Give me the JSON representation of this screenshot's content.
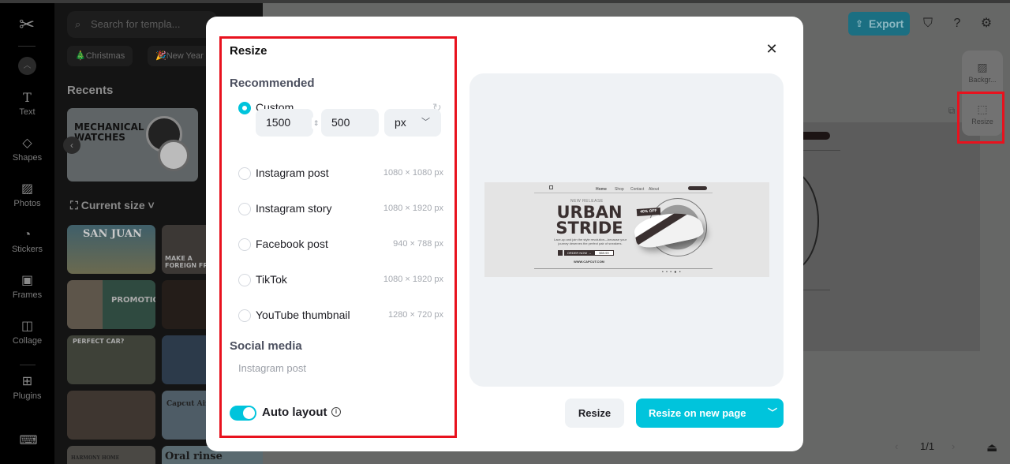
{
  "app": {
    "nav_rail": [
      {
        "label": "Text",
        "icon": "text-icon"
      },
      {
        "label": "Shapes",
        "icon": "shapes-icon"
      },
      {
        "label": "Photos",
        "icon": "photos-icon"
      },
      {
        "label": "Stickers",
        "icon": "stickers-icon"
      },
      {
        "label": "Frames",
        "icon": "frames-icon"
      },
      {
        "label": "Collage",
        "icon": "collage-icon"
      },
      {
        "label": "Plugins",
        "icon": "plugins-icon"
      }
    ],
    "search_placeholder": "Search for templa...",
    "chips": [
      "🎄Christmas",
      "🎉New Year"
    ],
    "recents_title": "Recents",
    "current_size_label": "Current size",
    "thumbnails": [
      {
        "caption": "MECHANICAL WATCHES"
      },
      {
        "caption": "SAN JUAN"
      },
      {
        "caption": "MAKE A FOREIGN FRI"
      },
      {
        "caption": "PROMOTION"
      },
      {
        "caption": "PERFECT CAR?"
      },
      {
        "caption": "Capcut Airline"
      },
      {
        "caption": "HARMONY HOME"
      },
      {
        "caption": "Oral rinse"
      }
    ],
    "export_label": "Export",
    "side_tools": [
      {
        "label": "Backgr...",
        "icon": "background-icon"
      },
      {
        "label": "Resize",
        "icon": "resize-icon"
      }
    ],
    "page_indicator": "1/1"
  },
  "modal": {
    "title": "Resize",
    "recommended_title": "Recommended",
    "custom": {
      "label": "Custom",
      "selected": true,
      "width": "1500",
      "height": "500",
      "unit": "px"
    },
    "presets": [
      {
        "label": "Instagram post",
        "dims": "1080 × 1080 px"
      },
      {
        "label": "Instagram story",
        "dims": "1080 × 1920 px"
      },
      {
        "label": "Facebook post",
        "dims": "940 × 788 px"
      },
      {
        "label": "TikTok",
        "dims": "1080 × 1920 px"
      },
      {
        "label": "YouTube thumbnail",
        "dims": "1280 × 720 px"
      }
    ],
    "social_title": "Social media",
    "social_items": [
      "Instagram post"
    ],
    "auto_layout_label": "Auto layout",
    "auto_layout_on": true,
    "preview": {
      "nav_links": [
        "Home",
        "Shop",
        "Contact",
        "About"
      ],
      "kicker": "NEW RELEASE",
      "headline_1": "URBAN",
      "headline_2": "STRIDE",
      "description": "Lace-up and join the style revolution—because your journey deserves the perfect pair of sneakers.",
      "order_label": "ORDER NOW →",
      "price": "$59.99",
      "badge": "40% OFF",
      "site": "WWW.CAPCUT.COM"
    },
    "resize_button": "Resize",
    "resize_new_page_button": "Resize on new page"
  },
  "colors": {
    "accent": "#00c4dc",
    "highlight": "#e8121e"
  }
}
